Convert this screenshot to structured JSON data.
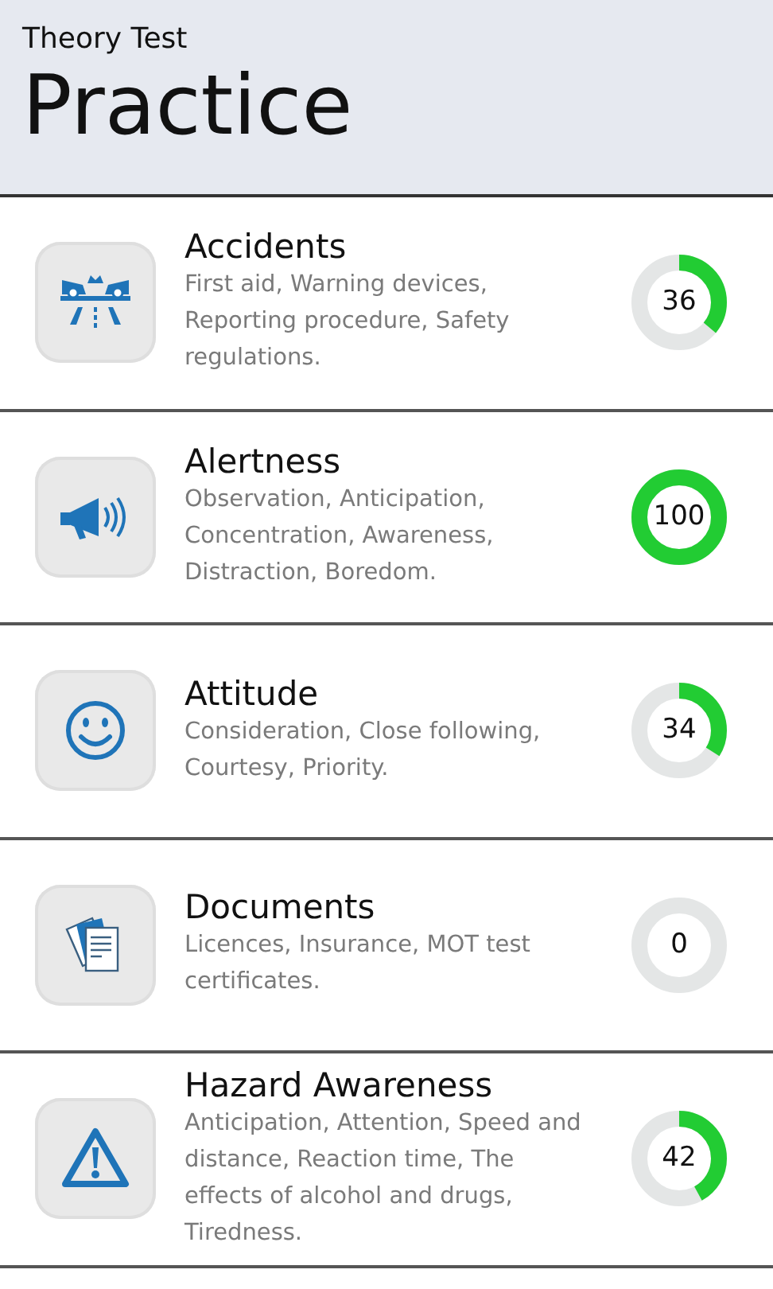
{
  "header": {
    "app_title": "Theory Test",
    "page_title": "Practice"
  },
  "topics": [
    {
      "kind": "accident",
      "title": "Accidents",
      "description": "First aid, Warning devices, Reporting procedure, Safety regulations.",
      "score": "36",
      "level": 0.36
    },
    {
      "kind": "megaphone",
      "title": "Alertness",
      "description": "Observation, Anticipation, Concentration, Awareness, Distraction, Boredom.",
      "score": "100",
      "level": 1.0
    },
    {
      "kind": "smiley",
      "title": "Attitude",
      "description": "Consideration, Close following, Courtesy, Priority.",
      "score": "34",
      "level": 0.34
    },
    {
      "kind": "documents",
      "title": "Documents",
      "description": "Licences, Insurance, MOT test certificates.",
      "score": "0"
    },
    {
      "kind": "warning",
      "title": "Hazard Awareness",
      "description": "Anticipation, Attention, Speed and distance, Reaction time, The effects of alcohol and drugs, Tiredness.",
      "score": "42",
      "level": 0.42
    }
  ]
}
